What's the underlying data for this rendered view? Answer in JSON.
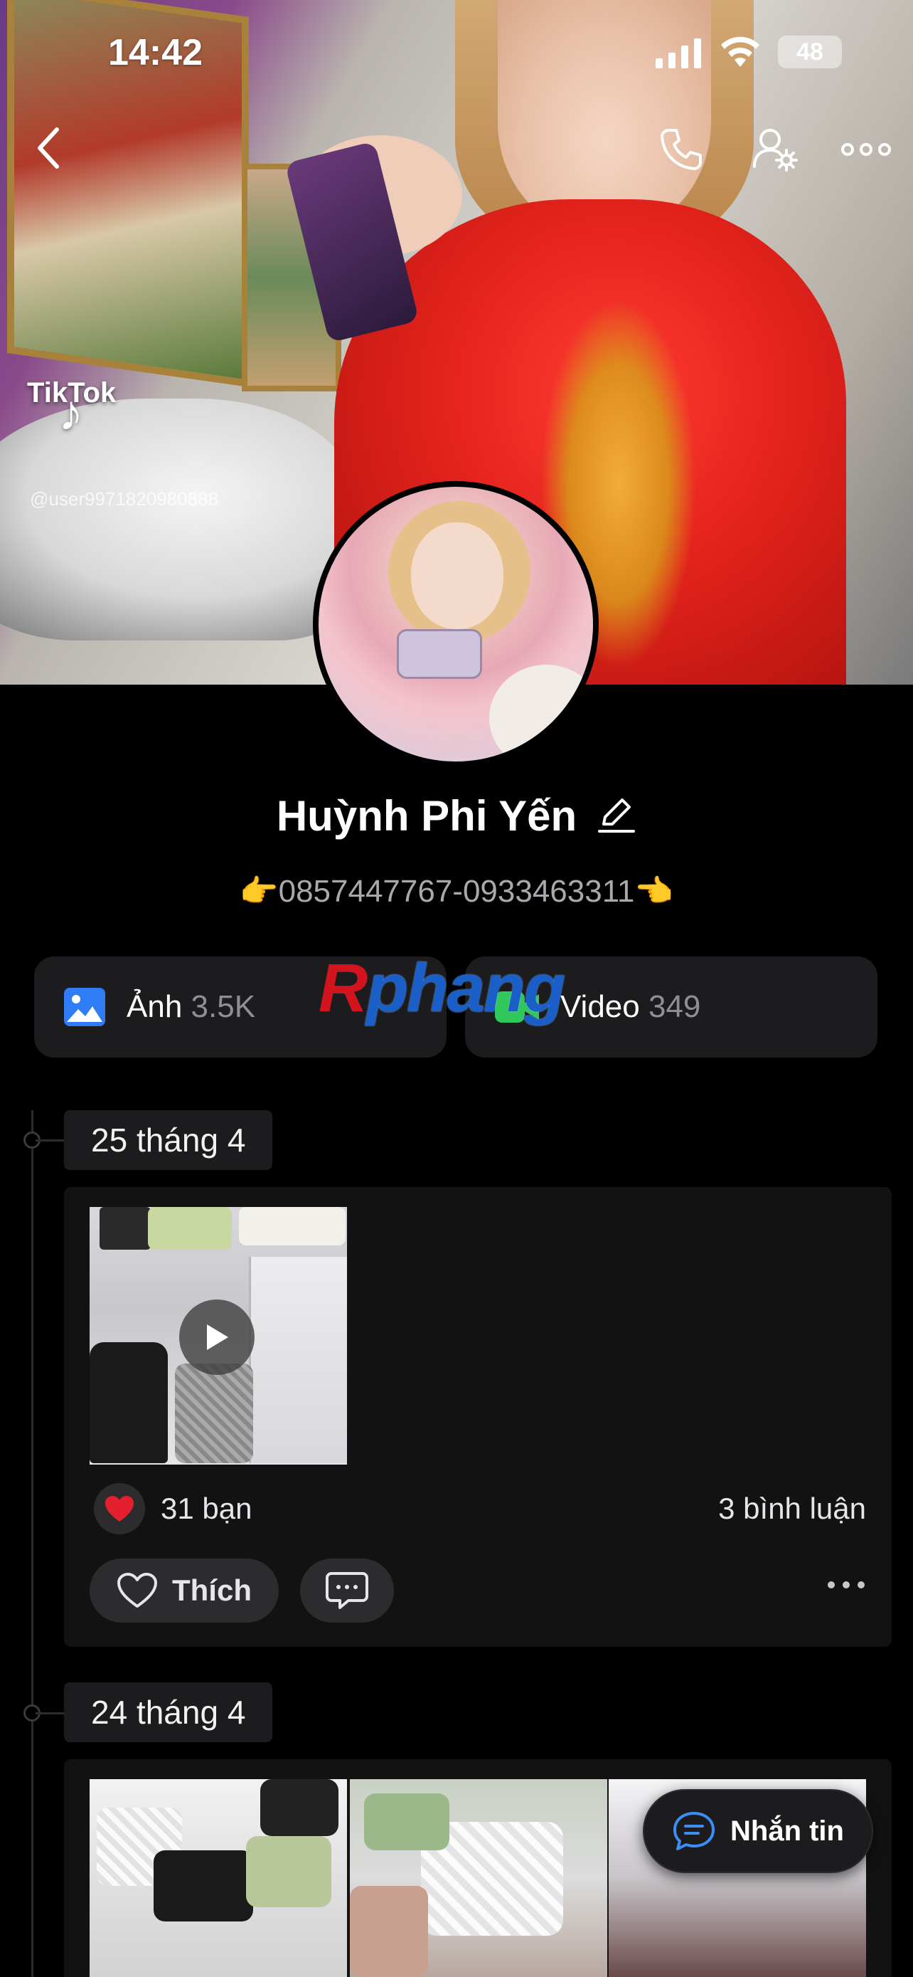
{
  "status_bar": {
    "time": "14:42",
    "battery": "48"
  },
  "cover": {
    "tiktok_logo_text": "TikTok",
    "tiktok_user": "@user9971820980888"
  },
  "profile": {
    "name": "Huỳnh Phi Yến",
    "bio": "👉0857447767-0933463311👈"
  },
  "media_tabs": [
    {
      "label": "Ảnh",
      "count": "3.5K",
      "icon": "photo-icon",
      "color": "#2f7cf6"
    },
    {
      "label": "Video",
      "count": "349",
      "icon": "video-camera-icon",
      "color": "#30c85a"
    }
  ],
  "watermark": {
    "r": "R",
    "rest": "phang"
  },
  "timeline": [
    {
      "date": "25 tháng 4",
      "reactions": "31 bạn",
      "comments": "3 bình luận",
      "like_label": "Thích"
    },
    {
      "date": "24 tháng 4"
    }
  ],
  "message_button": {
    "label": "Nhắn tin"
  },
  "colors": {
    "background": "#000000",
    "card": "#1c1c1e",
    "heart": "#e5202e"
  }
}
